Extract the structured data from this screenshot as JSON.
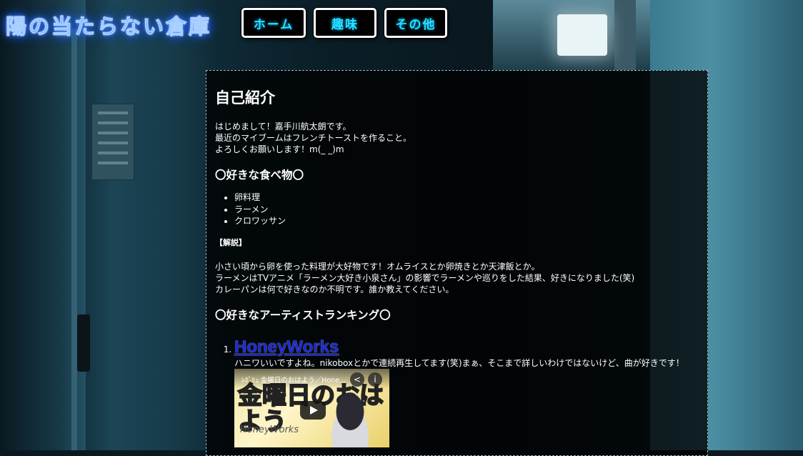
{
  "header": {
    "site_title": "陽の当たらない倉庫",
    "nav": [
      {
        "label": "ホーム"
      },
      {
        "label": "趣味"
      },
      {
        "label": "その他"
      }
    ]
  },
  "main": {
    "title": "自己紹介",
    "intro": [
      "はじめまして！嘉手川航太朗です。",
      "最近のマイブームはフレンチトーストを作ること。",
      "よろしくお願いします！m(_ _)m"
    ],
    "favorite_food": {
      "heading": "〇好きな食べ物〇",
      "items": [
        "卵料理",
        "ラーメン",
        "クロワッサン"
      ],
      "note_label": "【解説】",
      "explanation": [
        "小さい頃から卵を使った料理が大好物です！オムライスとか卵焼きとか天津飯とか。",
        "ラーメンはTVアニメ「ラーメン大好き小泉さん」の影響でラーメンや巡りをした結果、好きになりました(笑)",
        "カレーパンは何で好きなのか不明です。誰か教えてください。"
      ]
    },
    "artist_ranking": {
      "heading": "〇好きなアーティストランキング〇",
      "items": [
        {
          "name": "HoneyWorks",
          "comment": "ハニワいいですよね。nikoboxとかで連続再生してます(笑)まぁ、そこまで詳しいわけではないけど、曲が好きです！",
          "video": {
            "title": "金曜日のおはよう／Hone…",
            "channel_badge": "ﾚﾎﾞﾘｭ",
            "thumbnail_text": "金曜日のおはよう",
            "brand": "HoneyWorks",
            "share_icon": "share-icon",
            "info_icon": "info-icon"
          }
        }
      ]
    }
  },
  "colors": {
    "title_glow": "#2a6bff",
    "nav_text": "#28e0ff",
    "link": "#1c28d8",
    "panel_bg": "rgba(0,0,0,0.78)"
  }
}
